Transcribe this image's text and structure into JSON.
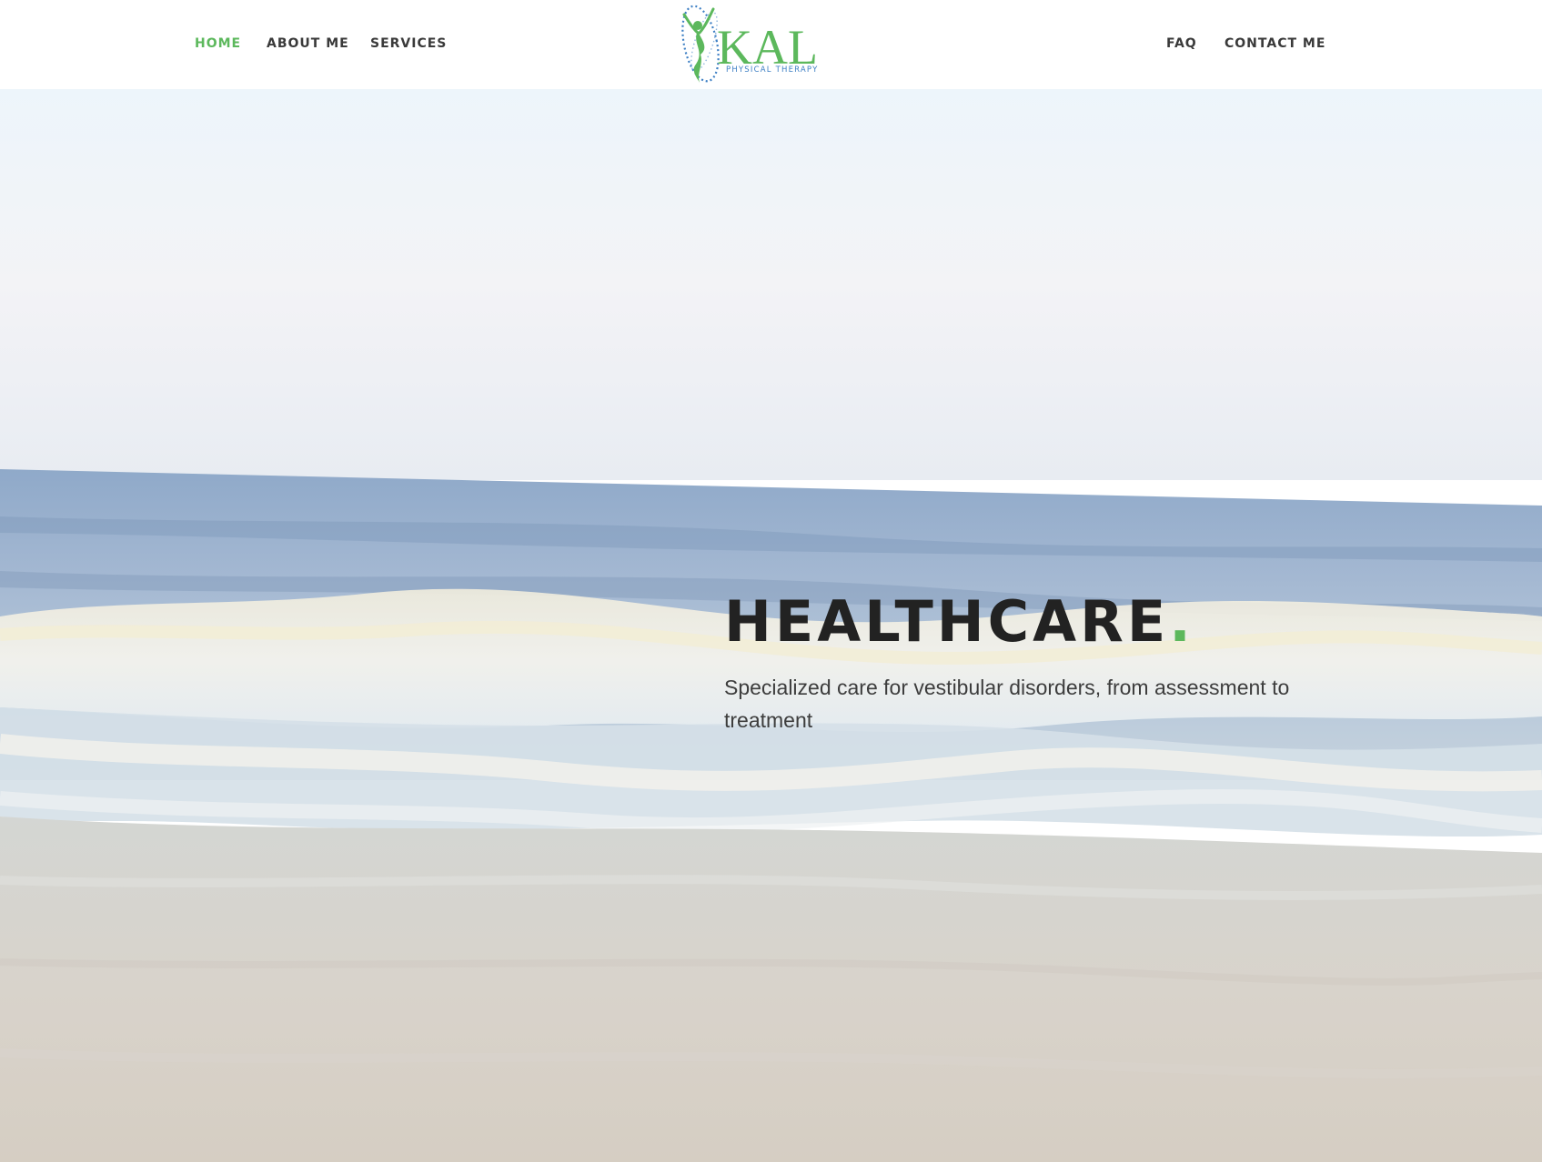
{
  "header": {
    "nav_left": [
      {
        "label": "HOME",
        "active": true
      },
      {
        "label": "ABOUT ME",
        "active": false
      },
      {
        "label": "SERVICES",
        "active": false
      }
    ],
    "nav_right": [
      {
        "label": "FAQ",
        "active": false
      },
      {
        "label": "CONTACT ME",
        "active": false
      }
    ],
    "logo": {
      "brand": "KAL",
      "tagline": "PHYSICAL THERAPY",
      "icon": "figure-spiral-logo-icon"
    }
  },
  "hero": {
    "title": "HEALTHCARE",
    "title_accent": ".",
    "subtitle": "Specialized care for vestibular disorders, from assessment to treatment",
    "background": "ocean-waves-beach-photo"
  },
  "colors": {
    "accent": "#5cb85c",
    "nav_text": "#3a3a3a",
    "title_text": "#222222",
    "logo_blue": "#3d7fc4"
  }
}
